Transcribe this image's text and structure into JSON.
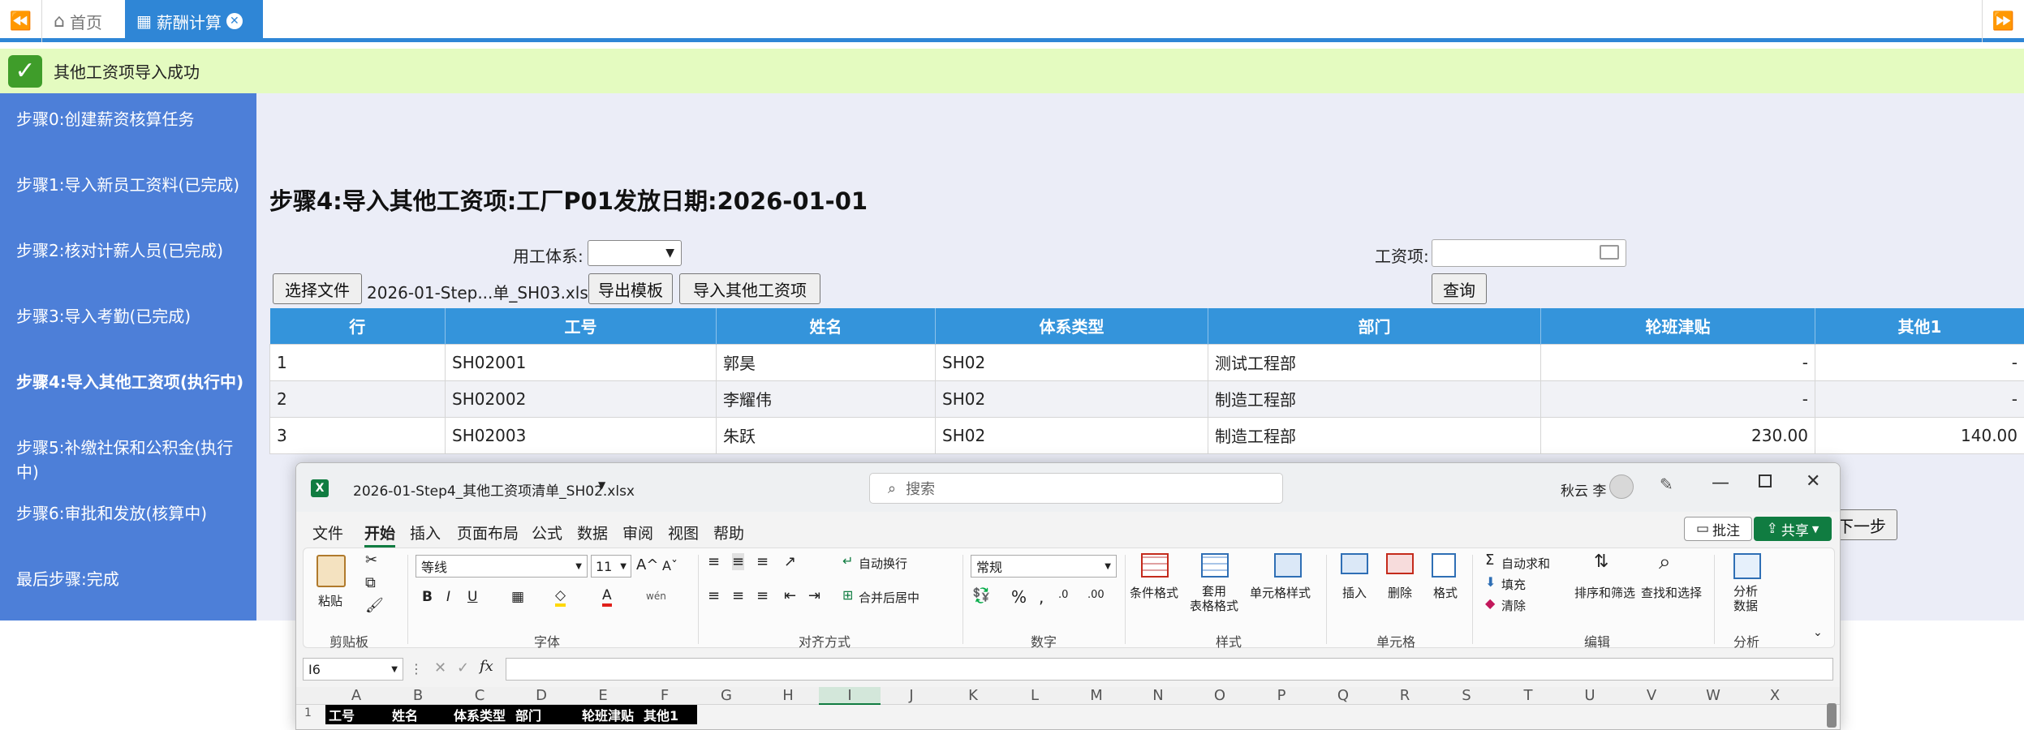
{
  "tabs": {
    "home": "首页",
    "active": "薪酬计算"
  },
  "notice": "其他工资项导入成功",
  "steps": [
    "步骤0:创建薪资核算任务",
    "步骤1:导入新员工资料(已完成)",
    "步骤2:核对计薪人员(已完成)",
    "步骤3:导入考勤(已完成)",
    "步骤4:导入其他工资项(执行中)",
    "步骤5:补缴社保和公积金(执行中)",
    "步骤6:审批和发放(核算中)",
    "最后步骤:完成"
  ],
  "page_title": "步骤4:导入其他工资项:工厂P01发放日期:2026-01-01",
  "form": {
    "system_label": "用工体系:",
    "system_value": "",
    "item_label": "工资项:",
    "choose_file": "选择文件",
    "file_name": "2026-01-Step...单_SH03.xlsx",
    "export_template": "导出模板",
    "import_items": "导入其他工资项",
    "query": "查询",
    "next": "下一步"
  },
  "table": {
    "headers": [
      "行",
      "工号",
      "姓名",
      "体系类型",
      "部门",
      "轮班津贴",
      "其他1"
    ],
    "rows": [
      [
        "1",
        "SH02001",
        "郭昊",
        "SH02",
        "测试工程部",
        "-",
        "-"
      ],
      [
        "2",
        "SH02002",
        "李耀伟",
        "SH02",
        "制造工程部",
        "-",
        "-"
      ],
      [
        "3",
        "SH02003",
        "朱跃",
        "SH02",
        "制造工程部",
        "230.00",
        "140.00"
      ]
    ]
  },
  "excel": {
    "file_title": "2026-01-Step4_其他工资项清单_SH02.xlsx",
    "search_placeholder": "搜索",
    "user": "秋云 李",
    "menu": [
      "文件",
      "开始",
      "插入",
      "页面布局",
      "公式",
      "数据",
      "审阅",
      "视图",
      "帮助"
    ],
    "comment": "批注",
    "share": "共享",
    "font_name": "等线",
    "font_size": "11",
    "number_format": "常规",
    "cell_ref": "I6",
    "ribbon": {
      "paste": "粘贴",
      "wrap": "自动换行",
      "merge": "合并后居中",
      "cond_format": "条件格式",
      "table_format": "套用\n表格格式",
      "cell_style": "单元格样式",
      "insert": "插入",
      "delete": "删除",
      "format": "格式",
      "autosum": "自动求和",
      "fill": "填充",
      "clear": "清除",
      "sort": "排序和筛选",
      "find": "查找和选择",
      "analyze": "分析\n数据"
    },
    "groups": [
      "剪贴板",
      "字体",
      "对齐方式",
      "数字",
      "样式",
      "单元格",
      "编辑",
      "分析"
    ],
    "columns": [
      "A",
      "B",
      "C",
      "D",
      "E",
      "F",
      "G",
      "H",
      "I",
      "J",
      "K",
      "L",
      "M",
      "N",
      "O",
      "P",
      "Q",
      "R",
      "S",
      "T",
      "U",
      "V",
      "W",
      "X"
    ],
    "row1": [
      "工号",
      "姓名",
      "体系类型",
      "部门",
      "轮班津贴",
      "其他1"
    ]
  }
}
